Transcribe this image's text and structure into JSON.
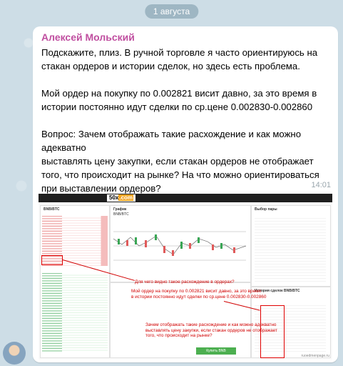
{
  "chat": {
    "date_badge": "1 августа",
    "message": {
      "author": "Алексей Мольский",
      "paragraph1": "Подскажите, плиз. В ручной торговле я часто ориентируюсь на стакан ордеров и истории сделок, но здесь есть проблема.",
      "paragraph2": "Мой ордер на покупку по 0.002821 висит давно, за это время в истории постоянно идут сделки по ср.цене 0.002830-0.002860",
      "paragraph3": "Вопрос: Зачем отображать такие расхождение и как можно адекватно\nвыставлять цену закупки, если стакан ордеров не отображает того, что происходит на рынке? На что можно ориентироваться при выставлении ордеров?",
      "time": "14:01"
    }
  },
  "screenshot": {
    "logo_main": "50x",
    "logo_accent": ".com",
    "orderbook_title": "BNB/BTC",
    "chart_title": "График",
    "chart_pair": "BNB/BTC",
    "tradeform_buy_label": "Купить BNB",
    "pairs_title": "Выбор пары",
    "history_title": "История сделок BNB/BTC",
    "annotation1": "Для чего видно такое расхождение в ордерах?",
    "annotation2": "Мой ордер на покупку по 0.002821 висит давно, за это время\nв истории постоянно идут сделки по ср.цене 0.002830-0.002860",
    "annotation3": "Зачем отображать такие расхождение и как можно адекватно\nвыставлять цену закупки, если стакан ордеров не отображает\nтого, что происходит на рынке?",
    "watermark": "ruoedmenpage.ru"
  },
  "colors": {
    "author": "#c04fa0",
    "annotation": "#d10000",
    "buy_button": "#4caf50"
  }
}
